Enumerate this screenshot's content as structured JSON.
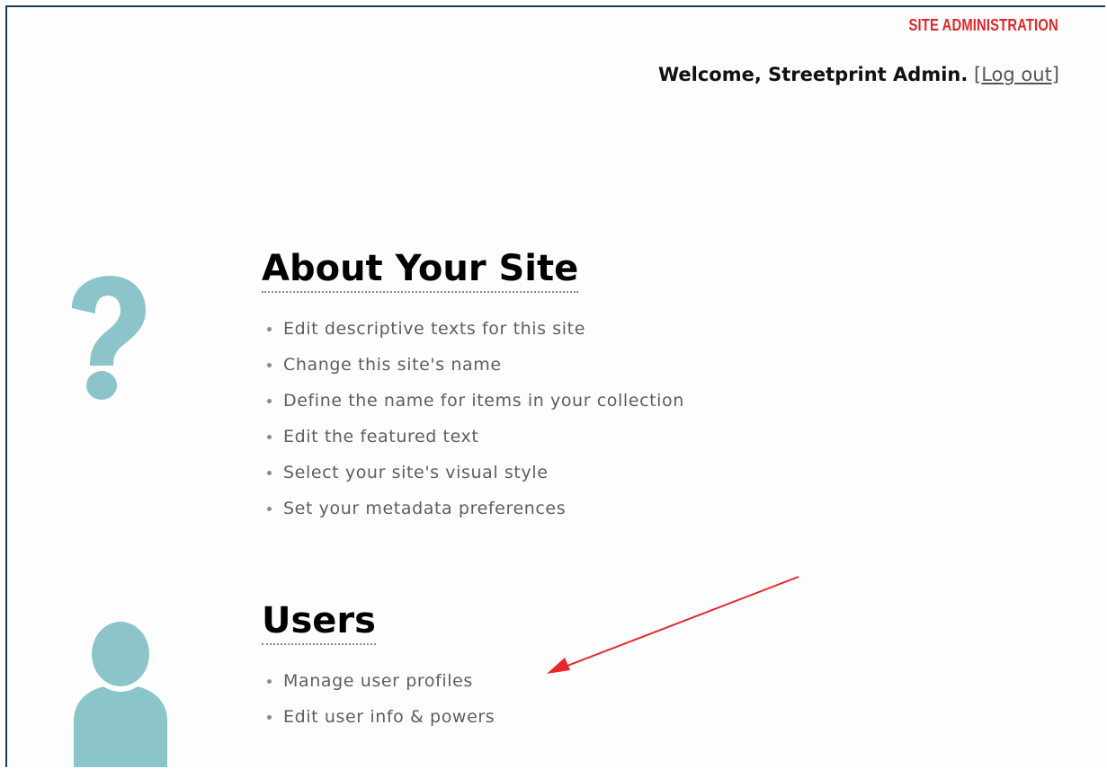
{
  "header": {
    "site_admin_label": "SITE ADMINISTRATION",
    "welcome_text": "Welcome, Streetprint Admin.",
    "logout_label": "[Log out]"
  },
  "sections": [
    {
      "title": "About Your Site",
      "icon": "question-mark-icon",
      "items": [
        "Edit descriptive texts for this site",
        "Change this site's name",
        "Define the name for items in your collection",
        "Edit the featured text",
        "Select your site's visual style",
        "Set your metadata preferences"
      ]
    },
    {
      "title": "Users",
      "icon": "user-silhouette-icon",
      "items": [
        "Manage user profiles",
        "Edit user info & powers"
      ]
    }
  ],
  "colors": {
    "accent_red": "#e0262b",
    "icon_teal": "#8cc5c9",
    "frame_border": "#1f3c55",
    "annotation_arrow": "#e8262a"
  }
}
